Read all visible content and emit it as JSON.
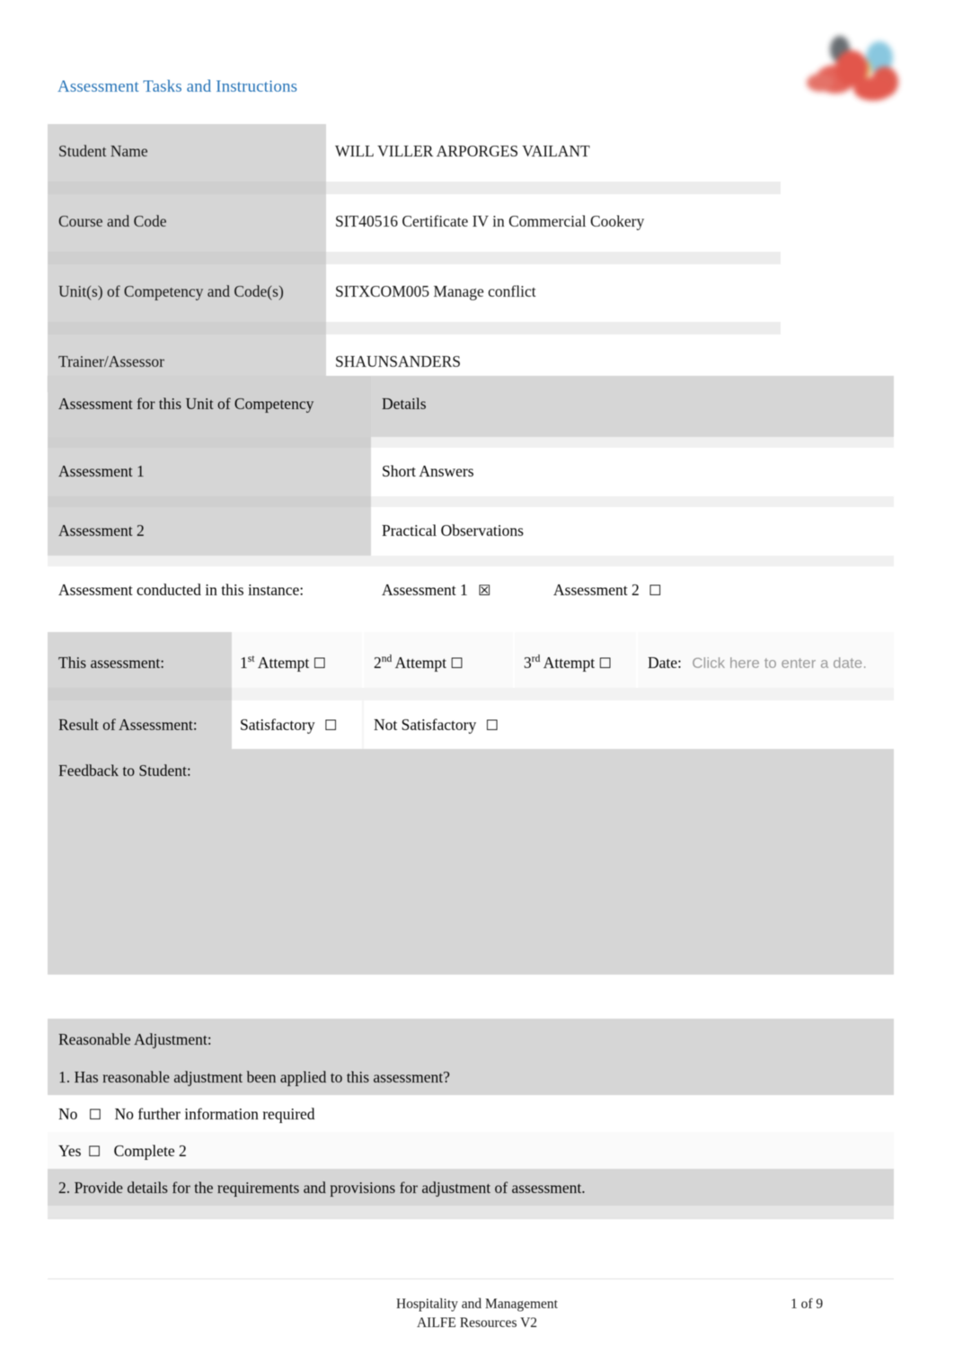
{
  "document": {
    "title": "Assessment Tasks and Instructions",
    "logo_name": "organisation-logo"
  },
  "student_details": {
    "rows": [
      {
        "label": "Student Name",
        "value": "WILL VILLER ARPORGES VAILANT"
      },
      {
        "label": "Course and Code",
        "value": "SIT40516 Certificate IV in Commercial Cookery"
      },
      {
        "label": "Unit(s) of Competency and Code(s)",
        "value": "SITXCOM005 Manage conflict"
      },
      {
        "label": "Trainer/Assessor",
        "value": "SHAUNSANDERS"
      }
    ]
  },
  "assessment_table": {
    "header": {
      "col1": "Assessment for this Unit of Competency",
      "col2": "Details"
    },
    "rows": [
      {
        "label": "Assessment 1",
        "details": "Short Answers"
      },
      {
        "label": "Assessment 2",
        "details": "Practical Observations"
      }
    ],
    "conducted": {
      "label": "Assessment conducted in this instance:",
      "option1_label": "Assessment 1",
      "option1_checkbox": "☒",
      "option2_label": "Assessment 2",
      "option2_checkbox": "☐"
    }
  },
  "this_assessment": {
    "label": "This assessment:",
    "attempts": [
      {
        "ordinal": "1",
        "suffix": "st",
        "text": " Attempt ",
        "checkbox": "☐"
      },
      {
        "ordinal": "2",
        "suffix": "nd",
        "text": " Attempt ",
        "checkbox": "☐"
      },
      {
        "ordinal": "3",
        "suffix": "rd",
        "text": " Attempt ",
        "checkbox": "☐"
      }
    ],
    "date_label": "Date:",
    "date_placeholder": "Click here to enter a date."
  },
  "result": {
    "label": "Result of Assessment:",
    "satisfactory_label": "Satisfactory",
    "satisfactory_checkbox": "☐",
    "not_satisfactory_label": "Not Satisfactory",
    "not_satisfactory_checkbox": "☐"
  },
  "feedback": {
    "label": "Feedback to Student:",
    "value": ""
  },
  "reasonable_adjustment": {
    "heading": "Reasonable Adjustment:",
    "question1": "1.   Has reasonable adjustment been applied to this assessment?",
    "no_label": "No",
    "no_checkbox": "☐",
    "no_text": "No further information required",
    "yes_label": "Yes",
    "yes_checkbox": "☐",
    "yes_text": "Complete 2",
    "question2": "2.   Provide details for the requirements and provisions for adjustment of assessment.",
    "answer_value": ""
  },
  "footer": {
    "line1": "Hospitality and Management",
    "line2": "AILFE Resources V2",
    "page": "1 of 9"
  },
  "colors": {
    "title_blue": "#1f6fb5",
    "shade_gray": "#d6d6d6",
    "light_gray": "#ececec",
    "placeholder_gray": "#9a9a9a"
  }
}
